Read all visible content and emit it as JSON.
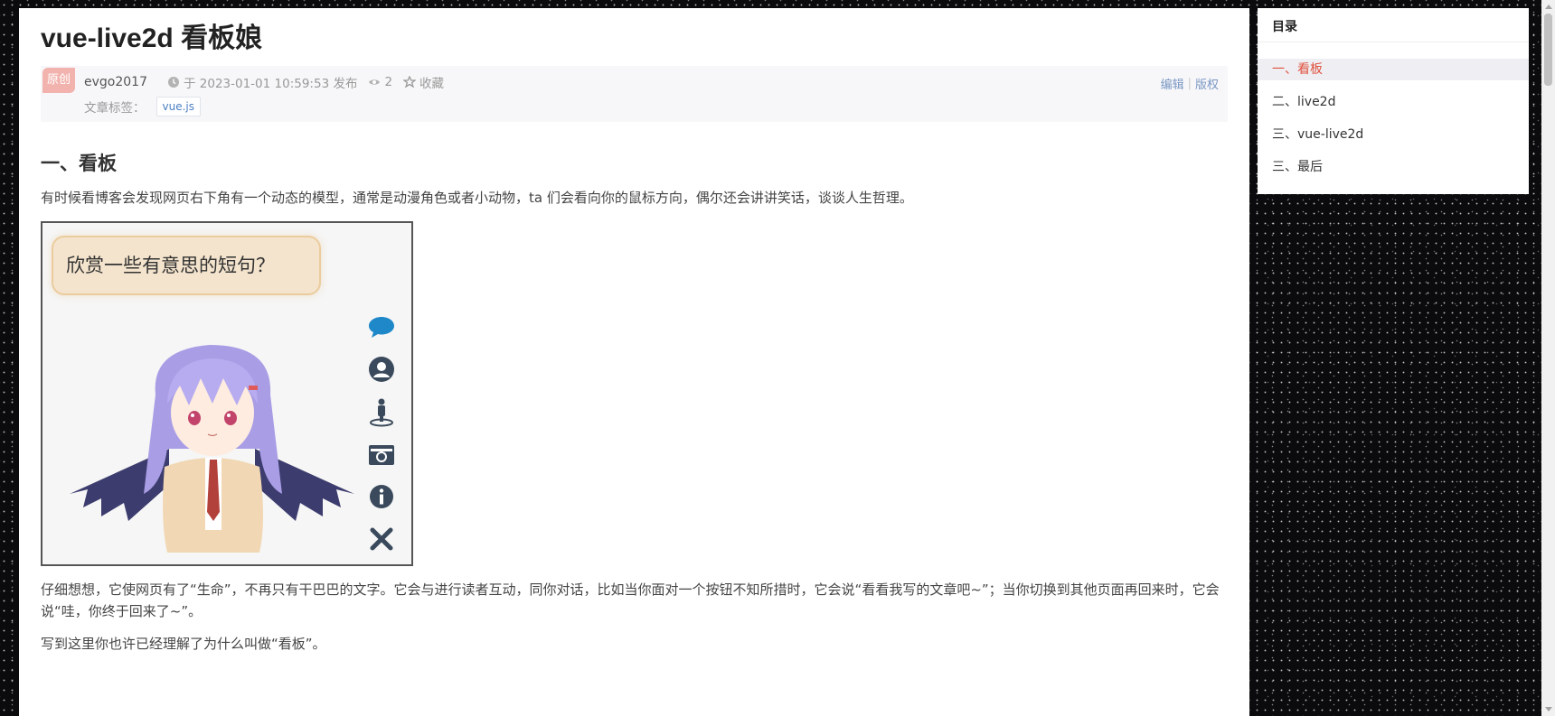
{
  "article": {
    "title": "vue-live2d 看板娘",
    "badge": "原创",
    "author": "evgo2017",
    "published": "于 2023-01-01 10:59:53 发布",
    "views": "2",
    "favorite_label": "收藏",
    "edit_label": "编辑",
    "copyright_label": "版权",
    "tags_label": "文章标签：",
    "tags": [
      "vue.js"
    ]
  },
  "content": {
    "section1_title": "一、看板",
    "section1_para1": "有时候看博客会发现网页右下角有一个动态的模型，通常是动漫角色或者小动物，ta 们会看向你的鼠标方向，偶尔还会讲讲笑话，谈谈人生哲理。",
    "figure_bubble": "欣赏一些有意思的短句？",
    "section1_para2": "仔细想想，它使网页有了“生命”，不再只有干巴巴的文字。它会与进行读者互动，同你对话，比如当你面对一个按钮不知所措时，它会说“看看我写的文章吧~”；当你切换到其他页面再回来时，它会说“哇，你终于回来了~”。",
    "section1_para3": "写到这里你也许已经理解了为什么叫做“看板”。"
  },
  "toc": {
    "title": "目录",
    "items": [
      "一、看板",
      "二、live2d",
      "三、vue-live2d",
      "三、最后"
    ],
    "active_index": 0
  },
  "icons": {
    "figure_tools": [
      "chat-icon",
      "user-icon",
      "figure-icon",
      "camera-icon",
      "info-icon",
      "close-icon"
    ]
  },
  "colors": {
    "accent": "#e0523f",
    "badge": "#f2b3ae",
    "tool_icon": "#1e88c8",
    "tool_icon_dark": "#3a4a5c"
  }
}
